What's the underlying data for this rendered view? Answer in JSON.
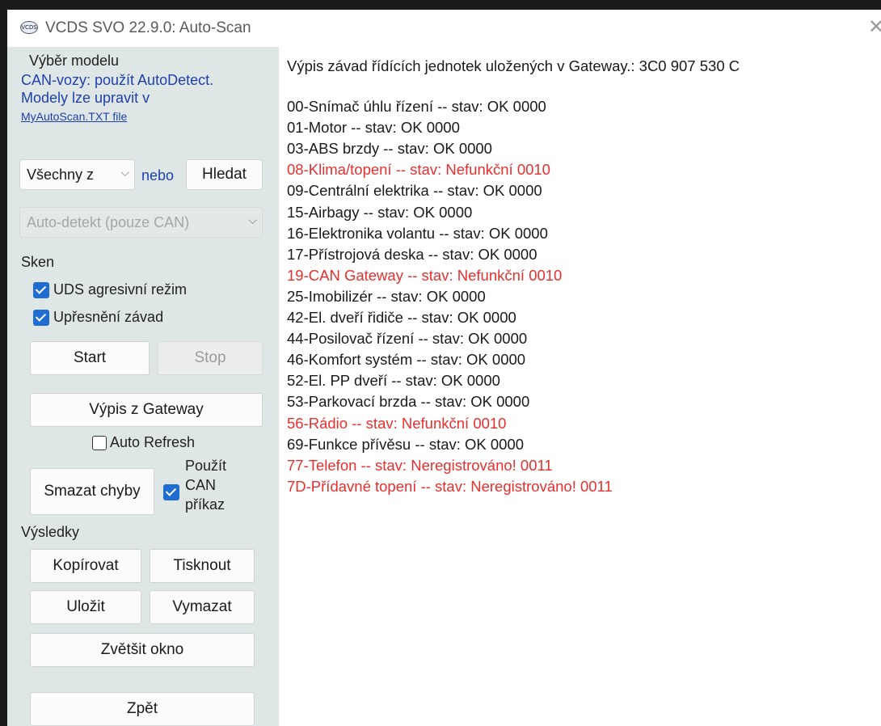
{
  "window": {
    "title": "VCDS SVO 22.9.0:  Auto-Scan",
    "close_icon": "close-icon",
    "app_icon_label": "VCDS"
  },
  "left_panel": {
    "model_heading": "Výběr modelu",
    "can_note_1": "CAN-vozy: použít AutoDetect.",
    "can_note_2": "Modely lze upravit v",
    "file_link": "MyAutoScan.TXT file",
    "model_select": "Všechny z",
    "or_label": "nebo",
    "search_button": "Hledat",
    "autodetect_select": "Auto-detekt (pouze CAN)",
    "scan_heading": "Sken",
    "uds_checkbox": {
      "label": "UDS agresivní režim",
      "checked": true
    },
    "refine_checkbox": {
      "label": "Upřesnění závad",
      "checked": true
    },
    "start_button": "Start",
    "stop_button": "Stop",
    "gateway_button": "Výpis z Gateway",
    "auto_refresh": {
      "label": "Auto Refresh",
      "checked": false
    },
    "clear_button": "Smazat chyby",
    "can_command": {
      "line1": "Použít",
      "line2": "CAN",
      "line3": "příkaz",
      "checked": true
    },
    "results_heading": "Výsledky",
    "copy_button": "Kopírovat",
    "print_button": "Tisknout",
    "save_button": "Uložit",
    "erase_button": "Vymazat",
    "enlarge_button": "Zvětšit okno",
    "back_button": "Zpět"
  },
  "results": {
    "header": "Výpis závad řídících jednotek uložených v Gateway.:  3C0 907 530 C",
    "colors": {
      "ok": "#1a1a1a",
      "fault": "#e8302e"
    },
    "lines": [
      {
        "text": "00-Snímač úhlu řízení -- stav: OK 0000",
        "status": "ok"
      },
      {
        "text": "01-Motor -- stav: OK 0000",
        "status": "ok"
      },
      {
        "text": "03-ABS brzdy -- stav: OK 0000",
        "status": "ok"
      },
      {
        "text": "08-Klima/topení -- stav: Nefunkční 0010",
        "status": "fault"
      },
      {
        "text": "09-Centrální elektrika -- stav: OK 0000",
        "status": "ok"
      },
      {
        "text": "15-Airbagy -- stav: OK 0000",
        "status": "ok"
      },
      {
        "text": "16-Elektronika volantu -- stav: OK 0000",
        "status": "ok"
      },
      {
        "text": "17-Přístrojová deska -- stav: OK 0000",
        "status": "ok"
      },
      {
        "text": "19-CAN Gateway -- stav: Nefunkční 0010",
        "status": "fault"
      },
      {
        "text": "25-Imobilizér -- stav: OK 0000",
        "status": "ok"
      },
      {
        "text": "42-El. dveří řidiče -- stav: OK 0000",
        "status": "ok"
      },
      {
        "text": "44-Posilovač řízení -- stav: OK 0000",
        "status": "ok"
      },
      {
        "text": "46-Komfort systém -- stav: OK 0000",
        "status": "ok"
      },
      {
        "text": "52-El. PP dveří -- stav: OK 0000",
        "status": "ok"
      },
      {
        "text": "53-Parkovací brzda -- stav: OK 0000",
        "status": "ok"
      },
      {
        "text": "56-Rádio -- stav: Nefunkční 0010",
        "status": "fault"
      },
      {
        "text": "69-Funkce přívěsu -- stav: OK 0000",
        "status": "ok"
      },
      {
        "text": "77-Telefon -- stav: Neregistrováno! 0011",
        "status": "fault"
      },
      {
        "text": "7D-Přídavné topení -- stav: Neregistrováno! 0011",
        "status": "fault"
      }
    ]
  }
}
